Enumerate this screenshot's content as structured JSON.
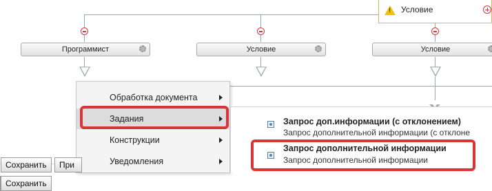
{
  "workflow": {
    "blocks": [
      {
        "label": "Программист"
      },
      {
        "label": "Условие"
      },
      {
        "label": "Условие"
      }
    ],
    "top_condition": {
      "label": "Условие"
    }
  },
  "toolbar": {
    "save_label": "Сохранить",
    "next_label_partial": "При"
  },
  "context_menu": {
    "items": [
      {
        "label": "Обработка документа"
      },
      {
        "label": "Задания"
      },
      {
        "label": "Конструкции"
      },
      {
        "label": "Уведомления"
      }
    ],
    "selected_index": 1
  },
  "submenu": {
    "items": [
      {
        "title": "Запрос доп.информации (с отклонением)",
        "description": "Запрос дополнительной информации (с отклоне"
      },
      {
        "title": "Запрос дополнительной информации",
        "description": "Запрос дополнительной информации"
      }
    ]
  },
  "colors": {
    "highlight": "#d7353a",
    "connector": "#9aa8b4",
    "menu_background": "#f4f4f4"
  }
}
